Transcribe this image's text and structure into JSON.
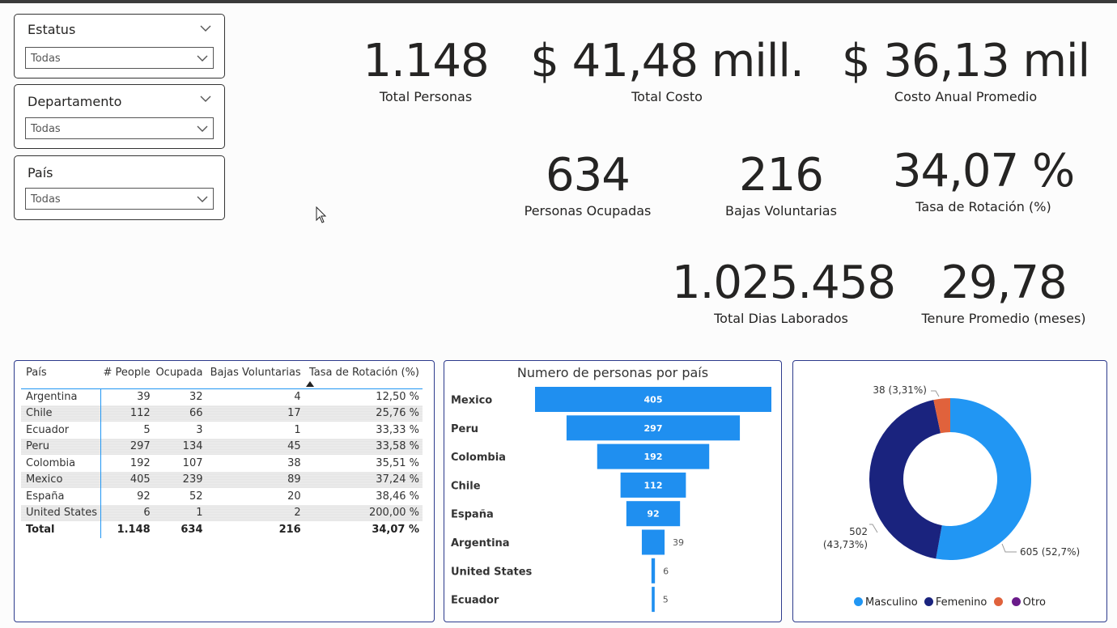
{
  "slicers": [
    {
      "title": "Estatus",
      "value": "Todas"
    },
    {
      "title": "Departamento",
      "value": "Todas"
    },
    {
      "title": "País",
      "value": "Todas"
    }
  ],
  "kpis": {
    "total_personas": {
      "value": "1.148",
      "label": "Total Personas"
    },
    "total_costo": {
      "value": "$ 41,48 mill.",
      "label": "Total Costo"
    },
    "costo_anual": {
      "value": "$ 36,13 mil",
      "label": "Costo Anual Promedio"
    },
    "personas_ocupadas": {
      "value": "634",
      "label": "Personas Ocupadas"
    },
    "bajas_voluntarias": {
      "value": "216",
      "label": "Bajas Voluntarias"
    },
    "tasa_rotacion": {
      "value": "34,07 %",
      "label": "Tasa de Rotación (%)"
    },
    "total_dias": {
      "value": "1.025.458",
      "label": "Total Dias Laborados"
    },
    "tenure": {
      "value": "29,78",
      "label": "Tenure Promedio (meses)"
    }
  },
  "table": {
    "headers": [
      "País",
      "# People",
      "Ocupada",
      "Bajas Voluntarias",
      "Tasa de Rotación (%)"
    ],
    "rows": [
      [
        "Argentina",
        "39",
        "32",
        "4",
        "12,50 %"
      ],
      [
        "Chile",
        "112",
        "66",
        "17",
        "25,76 %"
      ],
      [
        "Ecuador",
        "5",
        "3",
        "1",
        "33,33 %"
      ],
      [
        "Peru",
        "297",
        "134",
        "45",
        "33,58 %"
      ],
      [
        "Colombia",
        "192",
        "107",
        "38",
        "35,51 %"
      ],
      [
        "Mexico",
        "405",
        "239",
        "89",
        "37,24 %"
      ],
      [
        "España",
        "92",
        "52",
        "20",
        "38,46 %"
      ],
      [
        "United States",
        "6",
        "1",
        "2",
        "200,00 %"
      ]
    ],
    "total": [
      "Total",
      "1.148",
      "634",
      "216",
      "34,07 %"
    ]
  },
  "chart_data": [
    {
      "type": "bar",
      "title": "Numero de personas por país",
      "categories": [
        "Mexico",
        "Peru",
        "Colombia",
        "Chile",
        "España",
        "Argentina",
        "United States",
        "Ecuador"
      ],
      "values": [
        405,
        297,
        192,
        112,
        92,
        39,
        6,
        5
      ],
      "color": "#1f8ff0"
    },
    {
      "type": "pie",
      "categories": [
        "Masculino",
        "Femenino",
        "Otro"
      ],
      "values": [
        605,
        502,
        38
      ],
      "percent_labels": [
        "605 (52,7%)",
        "502 (43,73%)",
        "38 (3,31%)"
      ],
      "colors": [
        "#2196f3",
        "#1a237e",
        "#e0623c",
        "#6a1b8a"
      ],
      "legend": [
        "Masculino",
        "Femenino",
        "",
        "Otro"
      ]
    }
  ],
  "colors": {
    "accent": "#1f8ff0",
    "border": "#2c3a8c"
  }
}
